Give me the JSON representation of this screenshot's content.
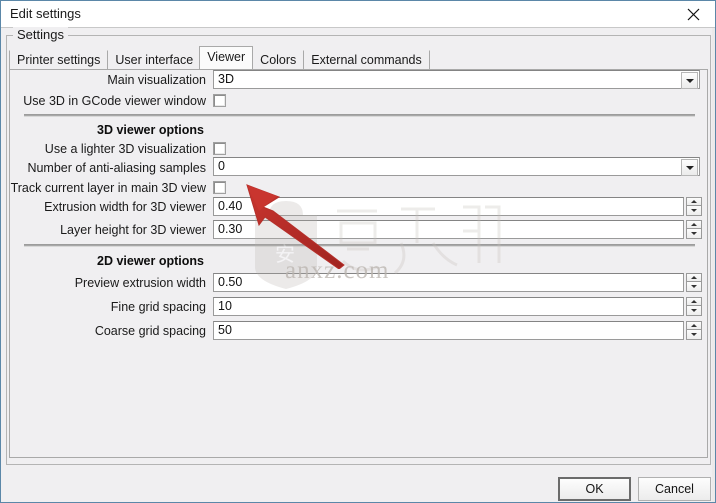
{
  "window": {
    "title": "Edit settings",
    "close_icon": "close-icon",
    "frame_color": "#5b87a8"
  },
  "group": {
    "legend": "Settings"
  },
  "tabs": [
    {
      "label": "Printer settings",
      "selected": false
    },
    {
      "label": "User interface",
      "selected": false
    },
    {
      "label": "Viewer",
      "selected": true
    },
    {
      "label": "Colors",
      "selected": false
    },
    {
      "label": "External commands",
      "selected": false
    }
  ],
  "top_rows": {
    "main_visualization": {
      "label": "Main visualization",
      "value": "3D",
      "dropdown_icon": "chevron-down-icon"
    },
    "use_3d_gcode": {
      "label": "Use 3D in GCode viewer window",
      "checked": false
    }
  },
  "section_3d": {
    "title": "3D viewer options",
    "lighter_3d": {
      "label": "Use a lighter 3D visualization",
      "checked": false
    },
    "antialias": {
      "label": "Number of anti-aliasing samples",
      "value": "0",
      "dropdown_icon": "chevron-down-icon"
    },
    "track_layer": {
      "label": "Track current layer in main 3D view",
      "checked": false
    },
    "extrusion_width": {
      "label": "Extrusion width for 3D viewer",
      "value": "0.40"
    },
    "layer_height": {
      "label": "Layer height for 3D viewer",
      "value": "0.30"
    }
  },
  "section_2d": {
    "title": "2D viewer options",
    "preview_extrusion_width": {
      "label": "Preview extrusion width",
      "value": "0.50"
    },
    "fine_grid": {
      "label": "Fine grid spacing",
      "value": "10"
    },
    "coarse_grid": {
      "label": "Coarse grid spacing",
      "value": "50"
    }
  },
  "footer": {
    "ok_label": "OK",
    "cancel_label": "Cancel"
  },
  "watermark": {
    "text": "anxz.com",
    "logo": "anxz-logo"
  }
}
